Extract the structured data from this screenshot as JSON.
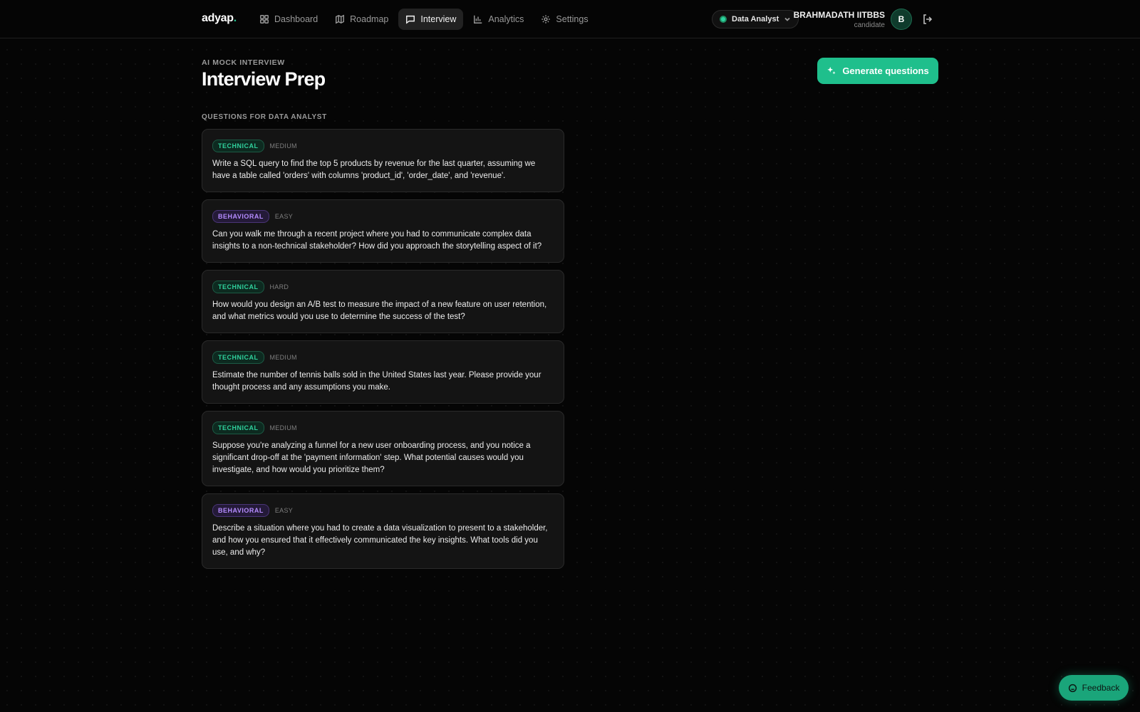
{
  "app": {
    "logo_text": "adyap",
    "logo_dot": "."
  },
  "nav": {
    "items": [
      {
        "label": "Dashboard",
        "icon": "dashboard-icon"
      },
      {
        "label": "Roadmap",
        "icon": "map-icon"
      },
      {
        "label": "Interview",
        "icon": "chat-icon",
        "active": true
      },
      {
        "label": "Analytics",
        "icon": "bar-chart-icon"
      },
      {
        "label": "Settings",
        "icon": "gear-icon"
      }
    ]
  },
  "role_selector": {
    "value": "Data Analyst"
  },
  "user": {
    "name": "BRAHMADATH IITBBS",
    "role": "candidate",
    "initial": "B"
  },
  "header": {
    "eyebrow": "AI MOCK INTERVIEW",
    "title": "Interview Prep",
    "generate_label": "Generate questions",
    "section_label": "QUESTIONS FOR DATA ANALYST"
  },
  "questions": [
    {
      "type": "TECHNICAL",
      "level": "MEDIUM",
      "text": "Write a SQL query to find the top 5 products by revenue for the last quarter, assuming we have a table called 'orders' with columns 'product_id', 'order_date', and 'revenue'."
    },
    {
      "type": "BEHAVIORAL",
      "level": "EASY",
      "text": "Can you walk me through a recent project where you had to communicate complex data insights to a non-technical stakeholder? How did you approach the storytelling aspect of it?"
    },
    {
      "type": "TECHNICAL",
      "level": "HARD",
      "text": "How would you design an A/B test to measure the impact of a new feature on user retention, and what metrics would you use to determine the success of the test?"
    },
    {
      "type": "TECHNICAL",
      "level": "MEDIUM",
      "text": "Estimate the number of tennis balls sold in the United States last year. Please provide your thought process and any assumptions you make."
    },
    {
      "type": "TECHNICAL",
      "level": "MEDIUM",
      "text": "Suppose you're analyzing a funnel for a new user onboarding process, and you notice a significant drop-off at the 'payment information' step. What potential causes would you investigate, and how would you prioritize them?"
    },
    {
      "type": "BEHAVIORAL",
      "level": "EASY",
      "text": "Describe a situation where you had to create a data visualization to present to a stakeholder, and how you ensured that it effectively communicated the key insights. What tools did you use, and why?"
    }
  ],
  "feedback": {
    "label": "Feedback"
  },
  "colors": {
    "accent": "#1fbf8c",
    "technical": "#2fd29d",
    "behavioral": "#b58cff",
    "background": "#050505",
    "card": "#141414"
  }
}
